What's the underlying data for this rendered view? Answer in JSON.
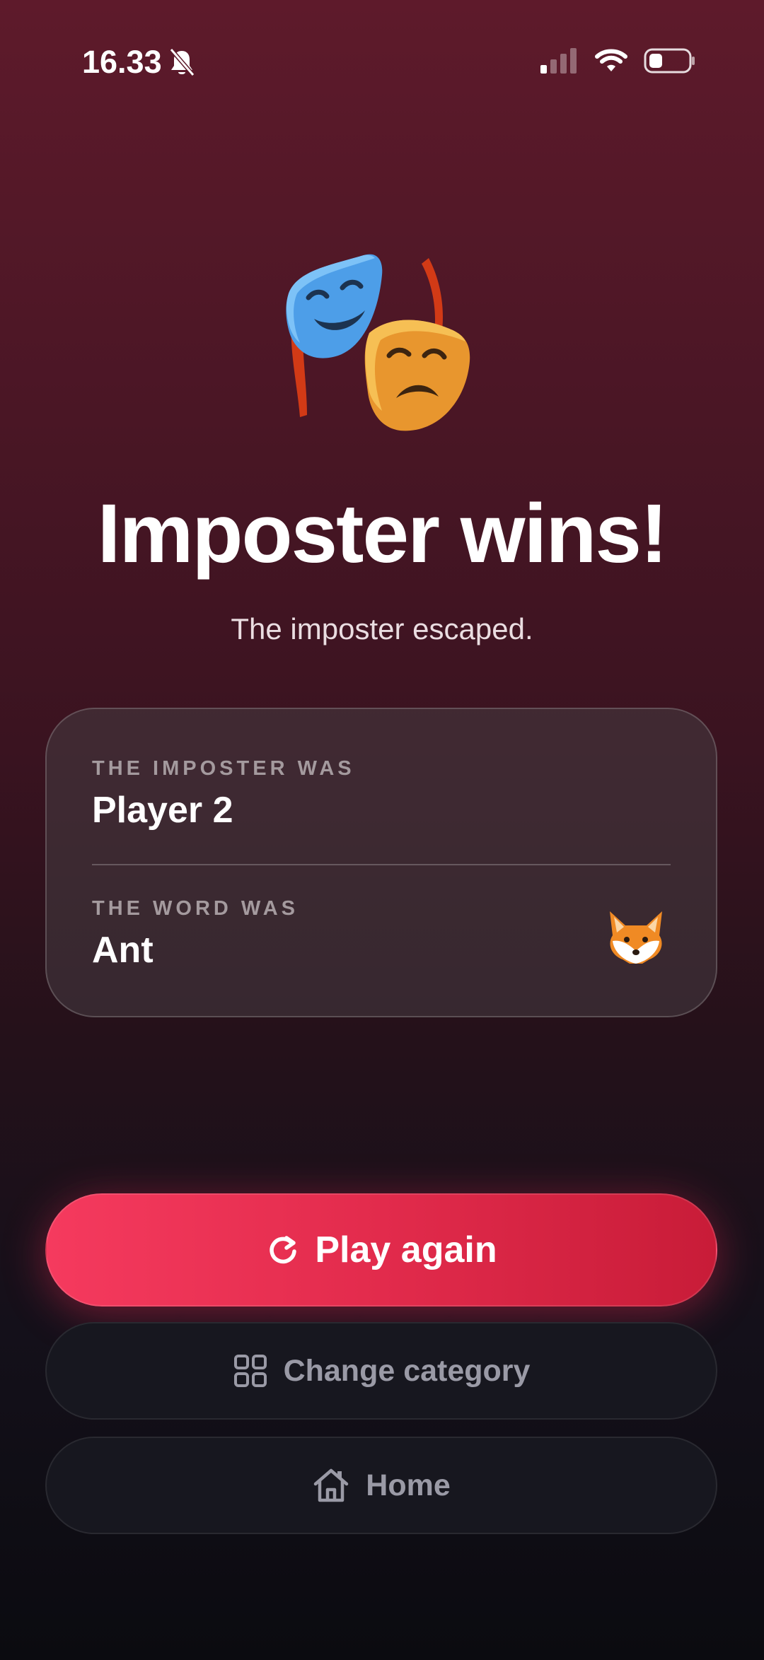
{
  "status_bar": {
    "time": "16.33",
    "icons": [
      "bell-slash-icon",
      "cellular-signal-icon",
      "wifi-icon",
      "battery-icon"
    ]
  },
  "result": {
    "emoji_icon": "performing-arts-masks-icon",
    "title": "Imposter wins!",
    "subtitle": "The imposter escaped."
  },
  "card": {
    "imposter_label": "THE IMPOSTER WAS",
    "imposter_value": "Player 2",
    "word_label": "THE WORD WAS",
    "word_value": "Ant",
    "word_icon": "fox-face-icon"
  },
  "actions": {
    "play_again": "Play again",
    "change_category": "Change category",
    "home": "Home"
  },
  "colors": {
    "primary_accent": "#e8304f",
    "background_top": "#5e1a2b",
    "background_bottom": "#0b0b10",
    "secondary_button": "#17171f"
  }
}
